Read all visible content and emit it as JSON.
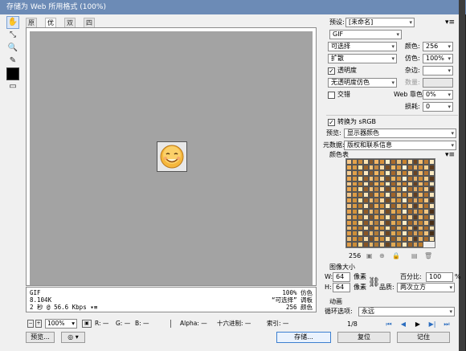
{
  "window": {
    "title": "存储为 Web 所用格式 (100%)"
  },
  "tools": [
    "hand-icon",
    "slice-select-icon",
    "zoom-icon",
    "eyedropper-icon",
    "color-swatch-icon",
    "preview-toggle-icon"
  ],
  "tabs": [
    {
      "label": "原稿",
      "active": false
    },
    {
      "label": "优化",
      "active": true
    },
    {
      "label": "双联",
      "active": false
    },
    {
      "label": "四联",
      "active": false
    }
  ],
  "info": {
    "format": "GIF",
    "size": "8.104K",
    "time": "2 秒 @ 56.6 Kbps",
    "time_menu": "▾≡",
    "dither": "100% 仿色",
    "palette": "“可选择” 调板",
    "colors": "256 颜色"
  },
  "status": {
    "zoom": "100%",
    "r": "R: —",
    "g": "G: —",
    "b": "B: —",
    "alpha": "Alpha: —",
    "hex": "十六进制: —",
    "index": "索引: —"
  },
  "buttons": {
    "preview": "预览...",
    "save": "存储...",
    "reset": "复位",
    "remember": "记住",
    "browser_label": "◎"
  },
  "settings": {
    "preset_label": "预设:",
    "preset_value": "[未命名]",
    "format_value": "GIF",
    "reduction_value": "可选择",
    "dither_algo_value": "扩散",
    "colors_label": "颜色:",
    "colors_value": "256",
    "dither_label": "仿色:",
    "dither_value": "100%",
    "matte_label": "杂边:",
    "matte_value": "",
    "transparency_label": "透明度",
    "transparency_checked": true,
    "trans_dither_value": "无透明度仿色",
    "amount_label": "数量:",
    "amount_value": "",
    "interlaced_label": "交错",
    "interlaced_checked": false,
    "websnap_label": "Web 靠色:",
    "websnap_value": "0%",
    "lossy_label": "损耗:",
    "lossy_value": "0"
  },
  "convert": {
    "srgb_label": "转换为 sRGB",
    "srgb_checked": true
  },
  "preview_row": {
    "label": "预览:",
    "value": "显示器颜色"
  },
  "metadata_row": {
    "label": "元数据:",
    "value": "版权和联系信息"
  },
  "colortable": {
    "title": "颜色表",
    "count": "256",
    "colors": [
      "#f7c98a",
      "#e3a24b",
      "#c98a3b",
      "#fbe2b0",
      "#8a5a2a",
      "#f2b566",
      "#d8913a",
      "#fff1cc",
      "#a86b2c",
      "#e9bf7a",
      "#c7822f",
      "#f9d79b",
      "#6e4420",
      "#f5c073",
      "#b97a34",
      "#fde9bf",
      "#efad55",
      "#d99a45",
      "#ffe3a8",
      "#9c6228",
      "#f3c57d",
      "#c58a44",
      "#faddaa",
      "#7a4e24",
      "#eeb864",
      "#d3903c",
      "#fff6da",
      "#b0702f",
      "#e7b26a",
      "#cf8a36",
      "#f7d08f",
      "#5e3a1c",
      "#f8cf95",
      "#e0a04a",
      "#c48233",
      "#fde8c0",
      "#8f5d2b",
      "#f0b561",
      "#d6943f",
      "#fff0c7",
      "#a5682c",
      "#e8c07e",
      "#c47f2e",
      "#f9d59a",
      "#6a4322",
      "#f4be70",
      "#b67532",
      "#fcebc4",
      "#eda953",
      "#d79842",
      "#ffe6ad",
      "#98602a",
      "#f2c37b",
      "#c28641",
      "#f9dca7",
      "#7c5025",
      "#ecb560",
      "#d18d3a",
      "#fff4d6",
      "#ad6e2e",
      "#e5b068",
      "#cc8835",
      "#f6ce8c",
      "#5a381b",
      "#f6cb90",
      "#dd9d48",
      "#c18031",
      "#fce6bc",
      "#8c5b2a",
      "#eeb25e",
      "#d4923d",
      "#ffeec3",
      "#a2662b",
      "#e6bd7b",
      "#c17c2d",
      "#f8d397",
      "#674121",
      "#f2bb6d",
      "#b37330",
      "#fbe9c1",
      "#eba751",
      "#d59640",
      "#ffe5aa",
      "#955e29",
      "#f0c078",
      "#bf843f",
      "#f8daa4",
      "#794e24",
      "#eab25d",
      "#ce8b38",
      "#fff2d2",
      "#aa6c2d",
      "#e3ad66",
      "#ca8634",
      "#f5cb89",
      "#56361a",
      "#f4c88c",
      "#db9b46",
      "#be7e30",
      "#fbe4b8",
      "#895929",
      "#ecb05c",
      "#d2903b",
      "#ffecbf",
      "#9f642a",
      "#e4bb78",
      "#be7a2c",
      "#f7d194",
      "#643f20",
      "#f0b96b",
      "#b0712f",
      "#fae7bd",
      "#e9a54f",
      "#d3943e",
      "#ffe3a6",
      "#925c28",
      "#eebe75",
      "#bc823d",
      "#f7d8a1",
      "#764c23",
      "#e8b05b",
      "#cb8937",
      "#fff0ce",
      "#a76a2c",
      "#e1ab63",
      "#c78433",
      "#f4c986",
      "#523419",
      "#f2c588",
      "#d99944",
      "#bb7c2f",
      "#fae2b4",
      "#865728",
      "#eaae5a",
      "#cf8e39",
      "#ffeabb",
      "#9c6229",
      "#e2b975",
      "#bb782b",
      "#f6cf91",
      "#613d1f",
      "#eeb769",
      "#ad6f2e",
      "#f9e5b9",
      "#e7a34d",
      "#d1923c",
      "#ffe1a2",
      "#8f5a27",
      "#ecbc72",
      "#b9803b",
      "#f6d69e",
      "#734a22",
      "#e6ae59",
      "#c88735",
      "#ffeecb",
      "#a4682b",
      "#dfa961",
      "#c48232",
      "#f3c783",
      "#4e3218",
      "#f0c384",
      "#d79742",
      "#b87a2e",
      "#f9e0b0",
      "#835527",
      "#e8ac58",
      "#cc8c37",
      "#ffe8b7",
      "#996028",
      "#e0b772",
      "#b8762a",
      "#f5cd8e",
      "#5e3b1e",
      "#ecb567",
      "#aa6d2d",
      "#f8e3b5",
      "#e5a14b",
      "#cf903a",
      "#ffdf9e",
      "#8c5826",
      "#eaba6f",
      "#b67e39",
      "#f5d49b",
      "#704821",
      "#e4ac57",
      "#c58533",
      "#ffecc7",
      "#a1662a",
      "#dda75f",
      "#c18031",
      "#f2c580",
      "#4a3017",
      "#eec180",
      "#d59540",
      "#b5782d",
      "#f8deac",
      "#805326",
      "#e6aa56",
      "#c98a35",
      "#ffe6b3",
      "#965e27",
      "#deb56f",
      "#b57429",
      "#f4cb8b",
      "#5b391d",
      "#eab365",
      "#a76b2c",
      "#f7e1b1",
      "#e39f49",
      "#cd8e38",
      "#ffdd9a",
      "#895625",
      "#e8b86c",
      "#b37c37",
      "#f4d298",
      "#6d4620",
      "#e2aa55",
      "#c28331",
      "#ffeac3",
      "#9e6429",
      "#dba55d",
      "#be7e30",
      "#f1c37d",
      "#472e16",
      "#ecbf7c",
      "#d3933e",
      "#b2762c",
      "#f7dca8",
      "#7d5125",
      "#e4a854",
      "#c68833",
      "#ffe4af",
      "#935c26",
      "#dcb36c",
      "#b27228",
      "#f3c988",
      "#58371c",
      "#e8b163",
      "#a4692b",
      "#f6dfad",
      "#e19d47",
      "#cb8c37",
      "#ffdb96",
      "#865424",
      "#e6b669",
      "#b07a35",
      "#f3d095",
      "#6a441f",
      "#e0a853",
      "#bf8130",
      "#ffe8bf",
      "#9b6228",
      "#d9a35b",
      "#bb7c2f"
    ]
  },
  "image_size": {
    "title": "图像大小",
    "w_label": "W:",
    "w_value": "64",
    "w_unit": "像素",
    "h_label": "H:",
    "h_value": "64",
    "h_unit": "像素",
    "percent_label": "百分比:",
    "percent_value": "100",
    "percent_unit": "%",
    "quality_label": "品质:",
    "quality_value": "两次立方"
  },
  "animation": {
    "title": "动画",
    "loop_label": "循环选项:",
    "loop_value": "永远",
    "frame": "1/8"
  }
}
